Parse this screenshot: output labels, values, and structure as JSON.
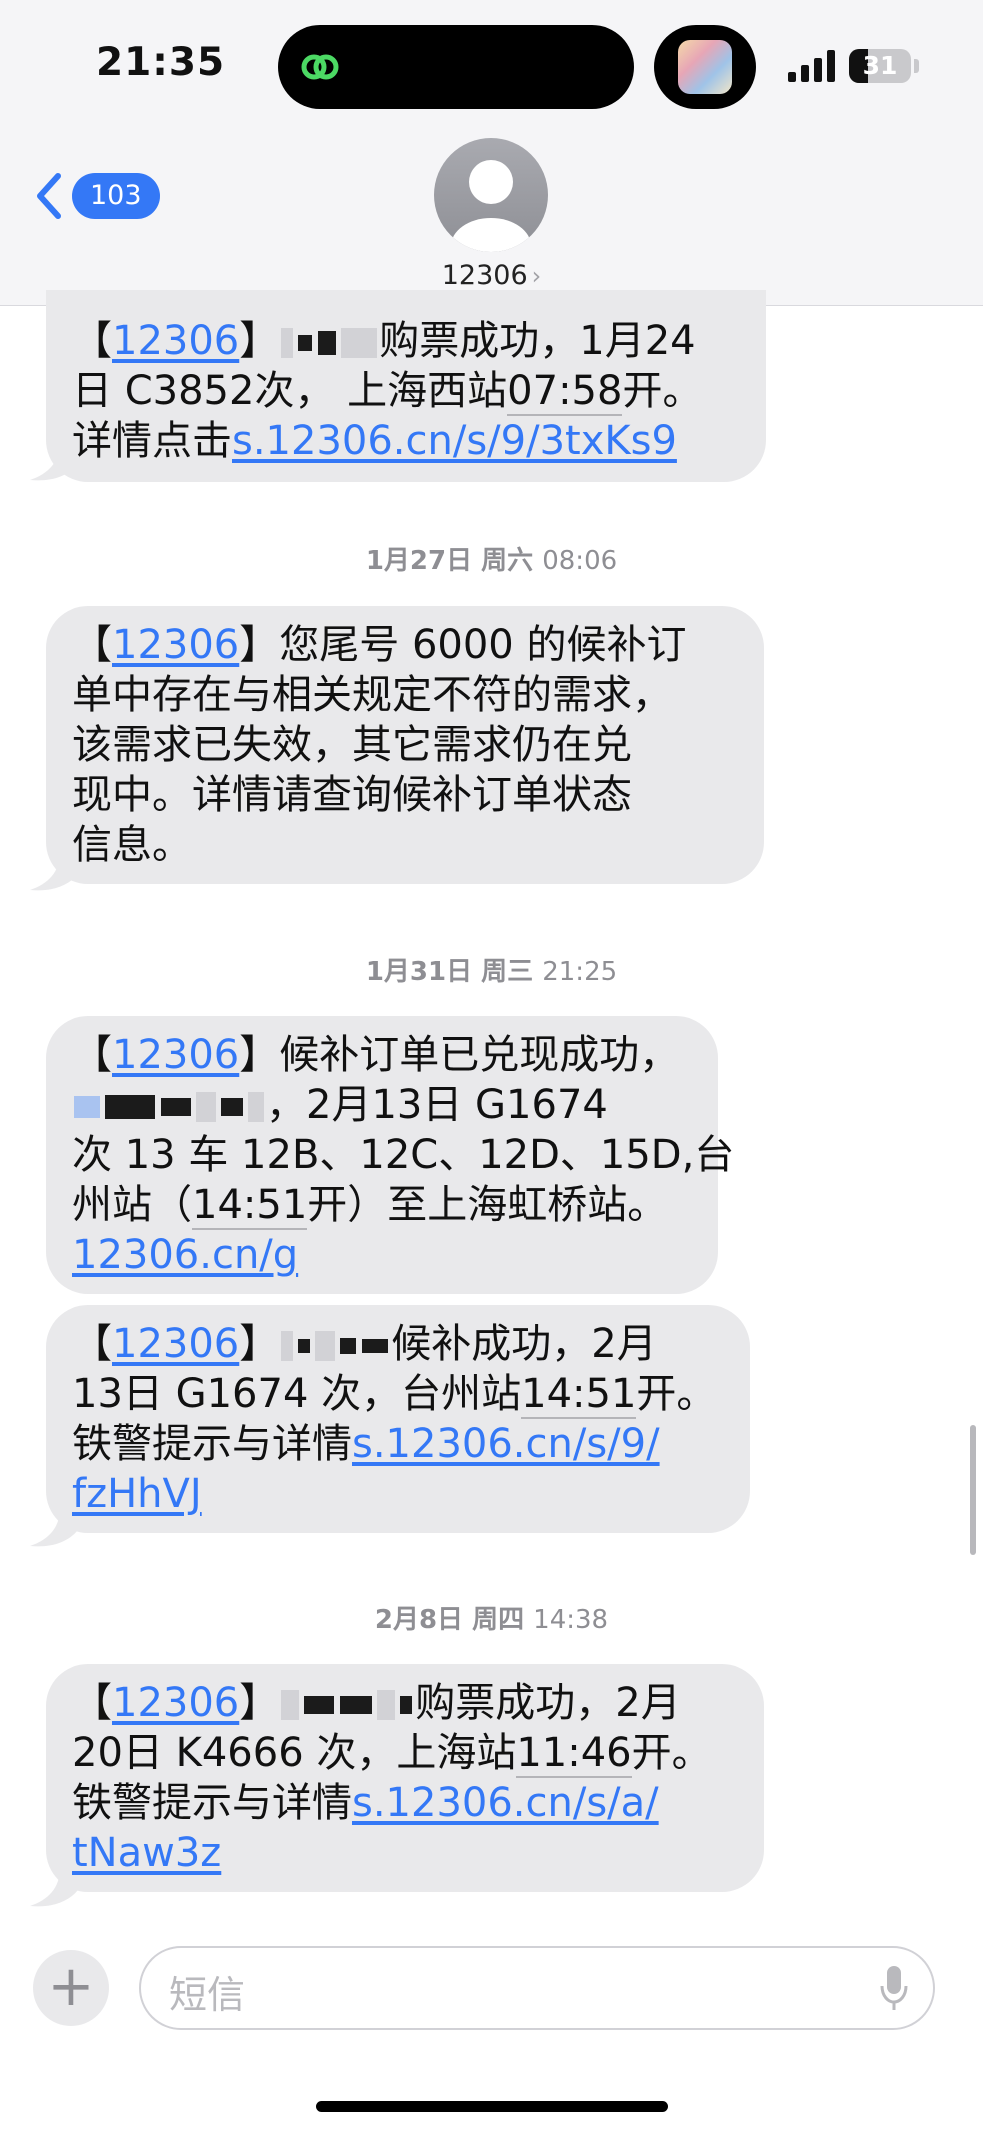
{
  "status_bar": {
    "time": "21:35",
    "battery": "31",
    "battery_level": 0.31,
    "island_icon": "link-app-icon",
    "signal_icon": "cellular-signal-icon"
  },
  "header": {
    "back_count": "103",
    "contact_name": "12306",
    "chevron": "›"
  },
  "timestamps": [
    {
      "date": "1月27日 周六",
      "time": "08:06"
    },
    {
      "date": "1月31日 周三",
      "time": "21:25"
    },
    {
      "date": "2月8日 周四",
      "time": "14:38"
    }
  ],
  "messages": [
    {
      "tag": "【12306】",
      "tag_link": "12306",
      "l1_tail": "购票成功，1月24",
      "l2_a": "日 C3852",
      "l2_b": "次，",
      "l2_c": "上海西站",
      "l2_time": "07:58",
      "l2_d": "开。",
      "l3_a": "详情点击",
      "link": "s.12306.cn/s/9/3txKs9"
    },
    {
      "tag_link": "12306",
      "l1": "您尾号 6000 的候补订",
      "l2": "单中存在与相关规定不符的需求，",
      "l3": "该需求已失效，其它需求仍在兑",
      "l4": "现中。详情请查询候补订单状态",
      "l5": "信息。"
    },
    {
      "tag_link": "12306",
      "l1": "候补订单已兑现成功，",
      "l2_tail": "，2月13日 G1674",
      "l3": "次 13 车 12B、12C、12D、15D,台",
      "l4_a": "州站（",
      "l4_time": "14:51",
      "l4_b": "开）至上海虹桥站。",
      "link": "12306.cn/g"
    },
    {
      "tag_link": "12306",
      "l1_tail": "候补成功，2月",
      "l2_a": "13日 G1674 次，台州站",
      "l2_time": "14:51",
      "l2_b": "开。",
      "l3_a": "铁警提示与详情",
      "link_a": "s.12306.cn/s/9/",
      "link_b": "fzHhVJ"
    },
    {
      "tag_link": "12306",
      "l1_tail": "购票成功，2月",
      "l2_a": "20日 K4666 次，上海站",
      "l2_time": "11:46",
      "l2_b": "开。",
      "l3_a": "铁警提示与详情",
      "link_a": "s.12306.cn/s/a/",
      "link_b": "tNaw3z"
    }
  ],
  "input_bar": {
    "placeholder": "短信",
    "plus": "+",
    "mic_icon": "microphone-icon"
  },
  "colors": {
    "accent": "#3478f6",
    "bubble": "#e9e9eb",
    "header_bg": "#f5f5f7",
    "timestamp": "#8e8e93"
  }
}
